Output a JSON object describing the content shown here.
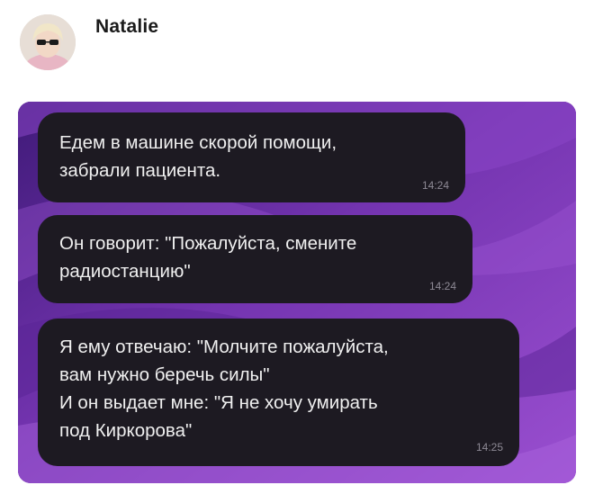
{
  "contact": {
    "name": "Natalie",
    "avatar_icon": "profile-photo"
  },
  "chat": {
    "background_colors": [
      "#4a1c86",
      "#7a35b5",
      "#9b4fd0"
    ],
    "bubble_color": "#1d1a22",
    "messages": [
      {
        "text": "Едем в машине скорой помощи,\nзабрали пациента.",
        "time": "14:24"
      },
      {
        "text": "Он говорит: \"Пожалуйста, смените\nрадиостанцию\"",
        "time": "14:24"
      },
      {
        "text": "Я ему отвечаю: \"Молчите пожалуйста,\nвам нужно беречь силы\"\nИ он выдает мне: \"Я не хочу умирать\nпод Киркорова\"",
        "time": "14:25"
      }
    ]
  }
}
